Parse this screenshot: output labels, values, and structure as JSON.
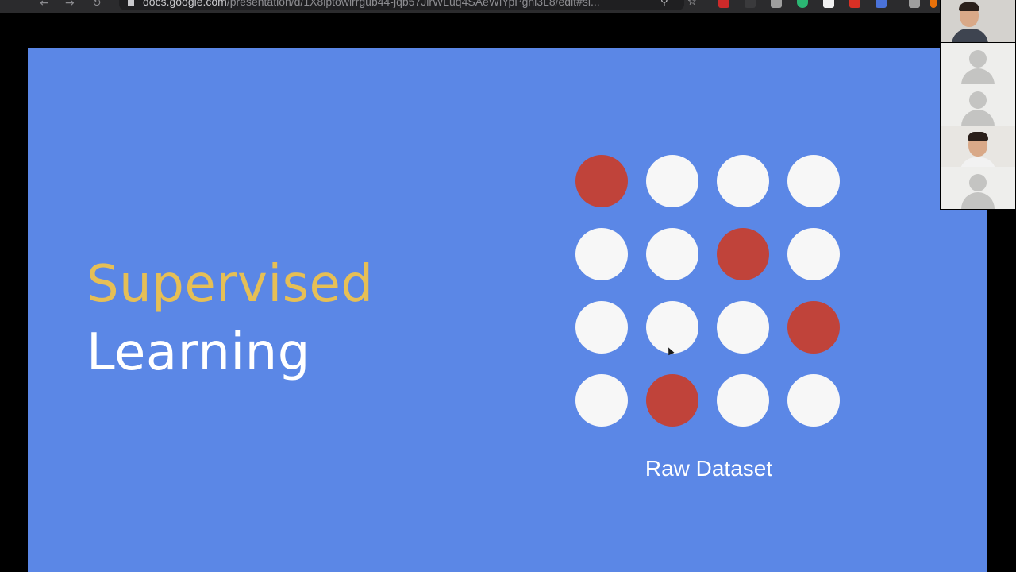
{
  "browser": {
    "url_host": "docs.google.com",
    "url_path": "/presentation/d/1X8lptowlrrgub44-jqb57JlrWLuq4SAeWlYpPgnl3L8/edit#sl...",
    "nav_icons": [
      "back-arrow-icon",
      "forward-arrow-icon",
      "reload-icon"
    ],
    "toolbar_icons": [
      "zoom-icon",
      "bookmark-star-icon"
    ],
    "extension_colors": [
      "#cc2a2a",
      "#3a3a3c",
      "#9e9e9e",
      "#2bb673",
      "#f0f0f0",
      "#d93025",
      "#4a72d9",
      "#9e9e9e",
      "#e8710a"
    ]
  },
  "slide": {
    "title_line1": "Supervised",
    "title_line2": "Learning",
    "dataset_label": "Raw Dataset",
    "background_color": "#5b87e6",
    "title_accent_color": "#e6bf55",
    "grid": {
      "rows": 4,
      "cols": 4,
      "cells": [
        "red",
        "white",
        "white",
        "white",
        "white",
        "white",
        "red",
        "white",
        "white",
        "white",
        "white",
        "red",
        "white",
        "red",
        "white",
        "white"
      ],
      "colors": {
        "red": "#c0433a",
        "white": "#f7f7f7"
      }
    }
  },
  "participants": {
    "tiles": [
      "self-video",
      "placeholder-avatar",
      "placeholder-avatar",
      "participant-video",
      "placeholder-avatar"
    ]
  }
}
